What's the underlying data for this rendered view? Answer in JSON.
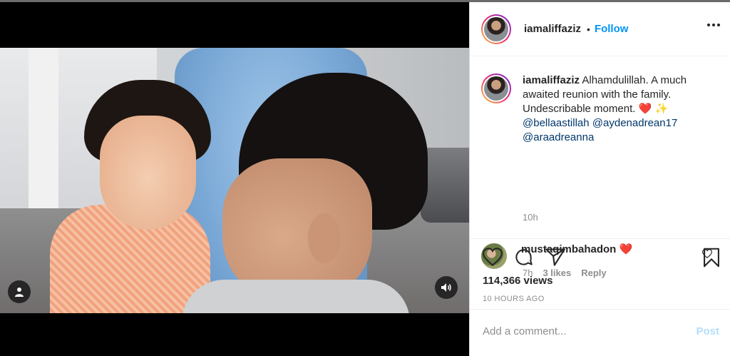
{
  "post": {
    "username": "iamaliffaziz",
    "separator": "•",
    "follow_label": "Follow",
    "more_icon": "more-horizontal-icon"
  },
  "caption": {
    "username": "iamaliffaziz",
    "text": "Alhamdulillah. A much awaited reunion with the family. Undescribable moment.",
    "emoji_heart": "❤️",
    "emoji_sparkle": "✨",
    "mentions": [
      "@bellaastillah",
      "@aydenadrean17",
      "@araadreanna"
    ],
    "time": "10h"
  },
  "comment": {
    "username": "mustaqimbahadon",
    "emoji": "❤️",
    "time": "7h",
    "likes": "3 likes",
    "reply_label": "Reply"
  },
  "actions": {
    "views": "114,366 views",
    "posted_ago": "10 HOURS AGO"
  },
  "add_comment": {
    "placeholder": "Add a comment...",
    "post_label": "Post"
  },
  "colors": {
    "link_blue": "#0095f6",
    "post_disabled": "#b2dffc",
    "muted": "#8e8e8e"
  }
}
